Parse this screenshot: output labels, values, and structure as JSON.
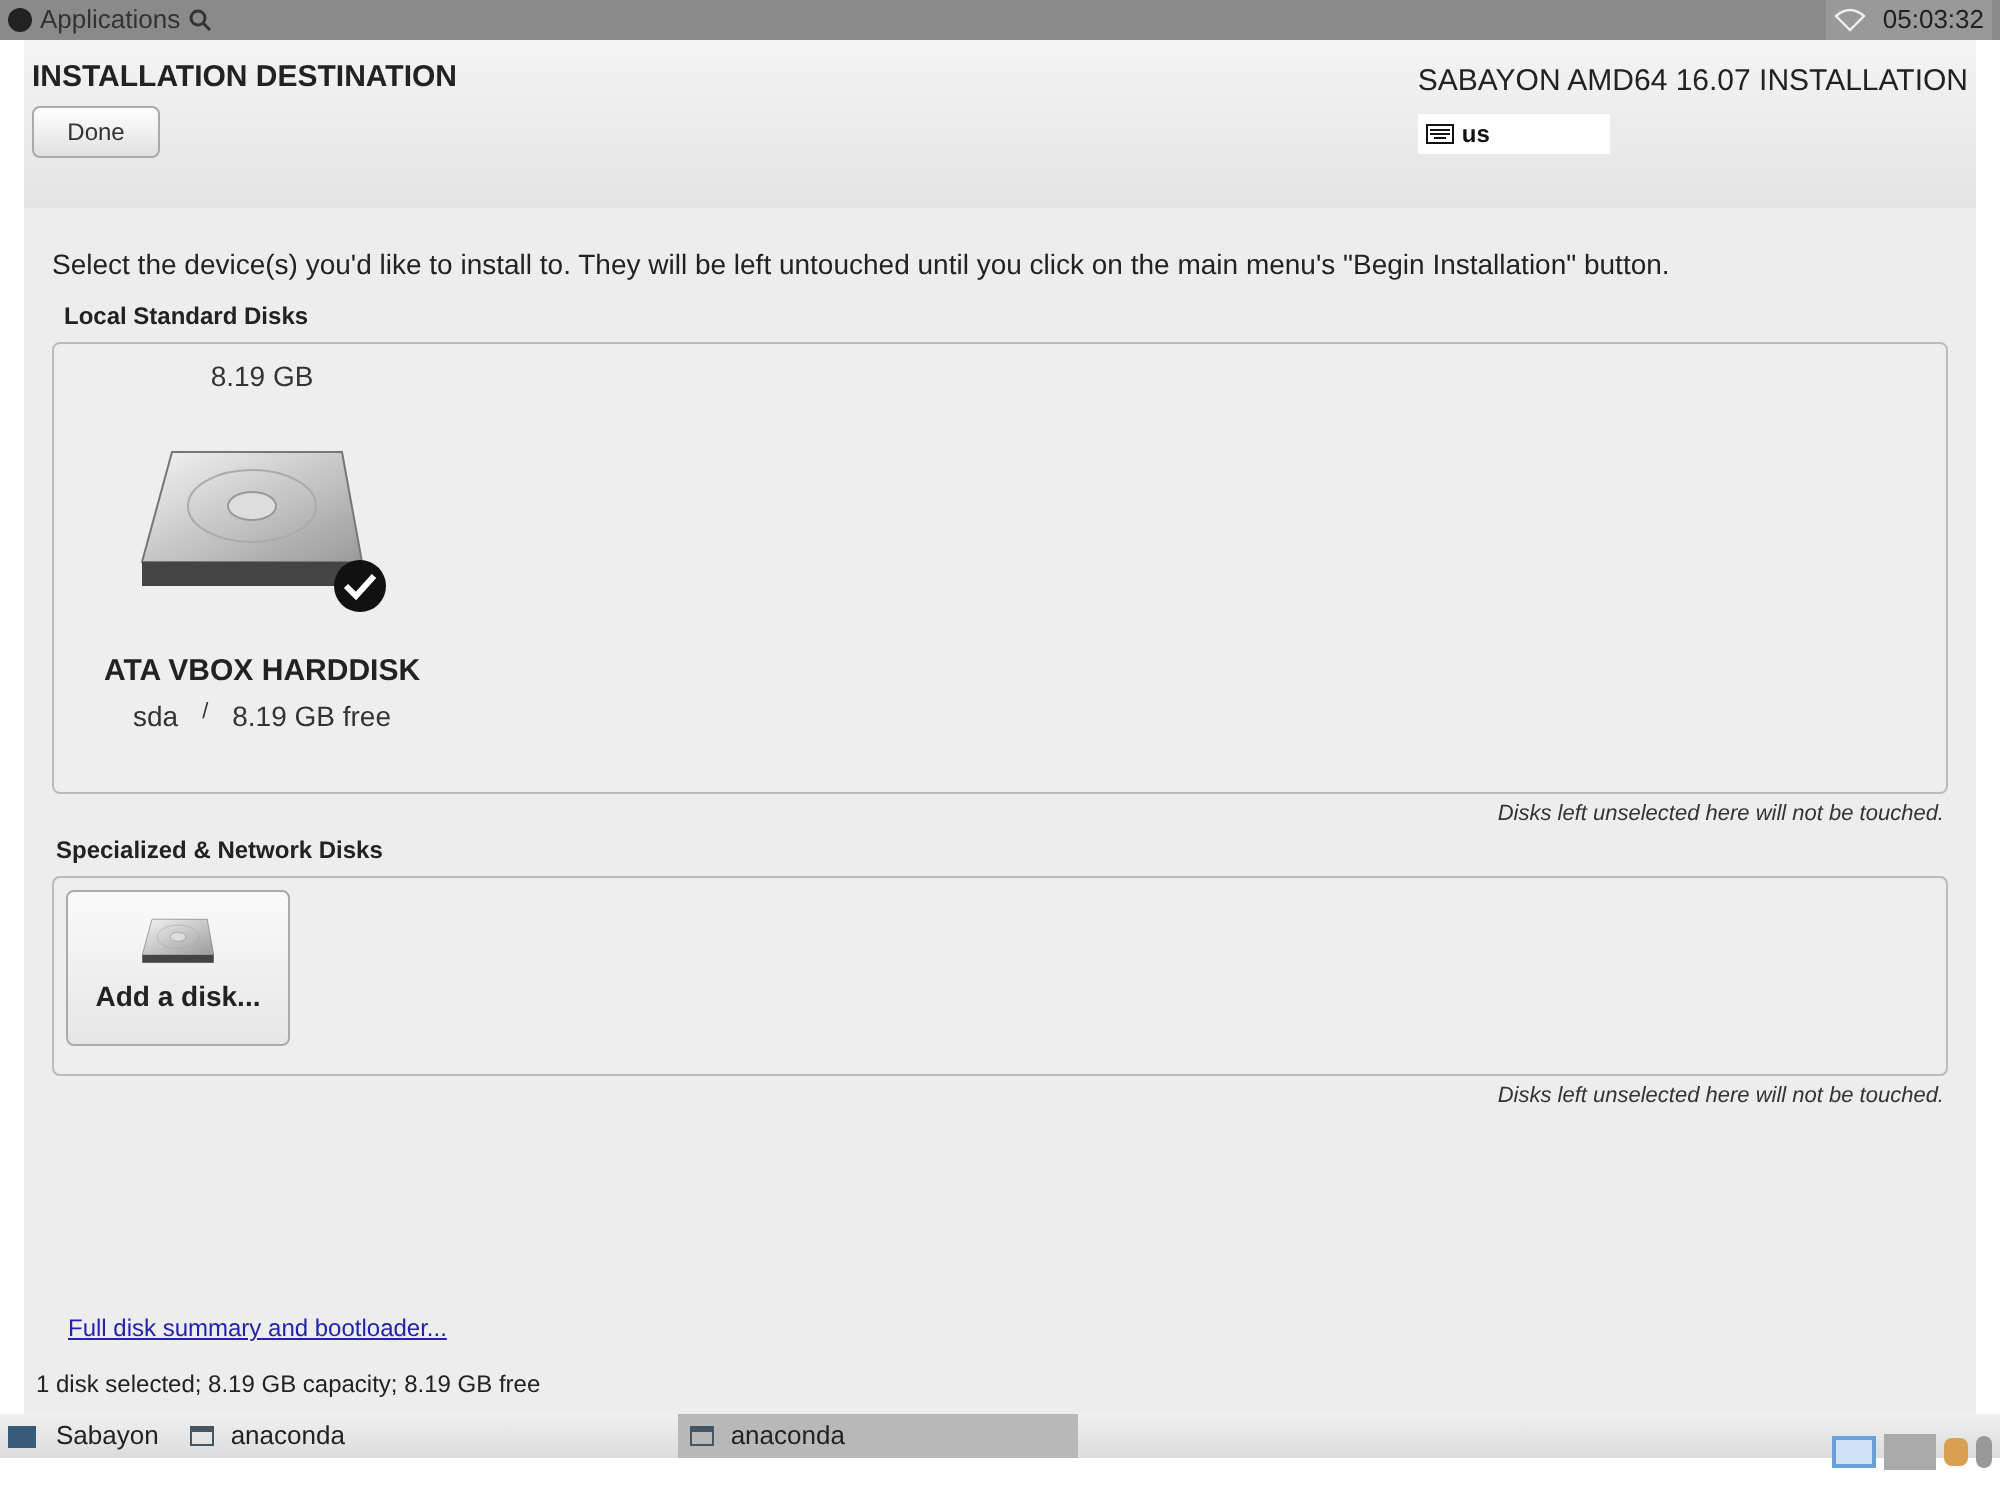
{
  "top_panel": {
    "menu": "Applications",
    "clock": "05:03:32"
  },
  "header": {
    "title": "INSTALLATION DESTINATION",
    "done_button": "Done",
    "product": "SABAYON AMD64 16.07 INSTALLATION",
    "keyboard_layout": "us"
  },
  "instructions": "Select the device(s) you'd like to install to.  They will be left untouched until you click on the main menu's \"Begin Installation\" button.",
  "local_disks": {
    "heading": "Local Standard Disks",
    "disks": [
      {
        "size": "8.19 GB",
        "name": "ATA VBOX HARDDISK",
        "device": "sda",
        "separator": "/",
        "free": "8.19 GB free",
        "selected": true
      }
    ],
    "note": "Disks left unselected here will not be touched."
  },
  "specialized_disks": {
    "heading": "Specialized & Network Disks",
    "add_button": "Add a disk...",
    "note": "Disks left unselected here will not be touched."
  },
  "summary_link": "Full disk summary and bootloader...",
  "status": "1 disk selected; 8.19 GB capacity; 8.19 GB free",
  "taskbar": {
    "start": "Sabayon",
    "windows": [
      {
        "label": "anaconda",
        "selected": false
      },
      {
        "label": "anaconda",
        "selected": true
      }
    ]
  }
}
